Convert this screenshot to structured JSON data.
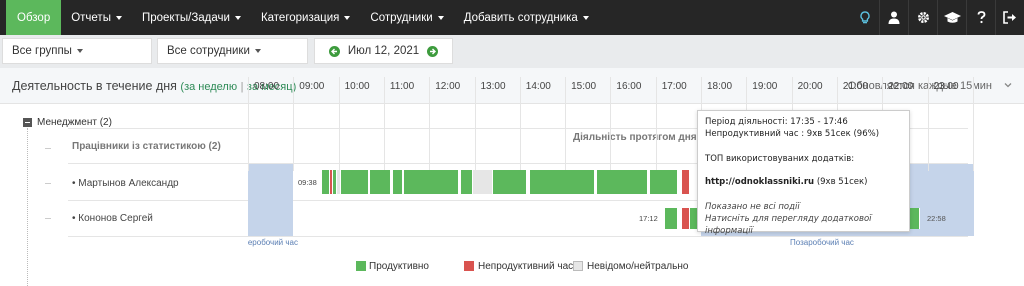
{
  "nav": {
    "items": [
      {
        "label": "Обзор",
        "active": true,
        "caret": false
      },
      {
        "label": "Отчеты",
        "caret": true
      },
      {
        "label": "Проекты/Задачи",
        "caret": true
      },
      {
        "label": "Категоризация",
        "caret": true
      },
      {
        "label": "Сотрудники",
        "caret": true
      },
      {
        "label": "Добавить сотрудника",
        "caret": true
      }
    ],
    "icons": [
      "lightbulb-icon",
      "user-icon",
      "gear-icon",
      "graduation-cap-icon",
      "help-icon",
      "logout-icon"
    ],
    "accent": "#5cb85c",
    "bg": "#262626"
  },
  "filters": {
    "groups": "Все группы",
    "employees": "Все сотрудники",
    "date": "Июл 12, 2021"
  },
  "panel": {
    "title": "Деятельность в течение дня",
    "link_week": "за неделю",
    "separator": "|",
    "link_month": "за месяц",
    "paren_open": "(",
    "paren_close": ")",
    "update_note": "Обновляется каждые 15мин"
  },
  "tree": {
    "group_label": "Менеджмент (2)",
    "column_title": "Працівники із статистикою (2)",
    "axis_title": "Діяльність протягом дня",
    "employees": [
      {
        "name": "• Мартынов Александр",
        "start_label": "09:38"
      },
      {
        "name": "• Кононов Сергей",
        "start_label": "17:12",
        "end_label": "22:58"
      }
    ]
  },
  "hours": [
    "08:00",
    "09:00",
    "10:00",
    "11:00",
    "12:00",
    "13:00",
    "14:00",
    "15:00",
    "16:00",
    "17:00",
    "18:00",
    "19:00",
    "20:00",
    "21:00",
    "22:00",
    "23:00"
  ],
  "nonwork_left": "Неробочий час",
  "nonwork_right": "Позаробочий час",
  "legend": {
    "productive": "Продуктивно",
    "unproductive": "Непродуктивний час",
    "neutral": "Невідомо/нейтрально"
  },
  "colors": {
    "productive": "#5cb85c",
    "unproductive": "#d9534f",
    "neutral": "#e6e6e6",
    "offhours": "#c5d4ea"
  },
  "tooltip": {
    "period": "Період діяльності: 17:35 - 17:46",
    "unproductive": "Непродуктивний час : 9хв 51сек (96%)",
    "top_apps": "ТОП використовуваних додатків:",
    "app_name": "http://odnoklassniki.ru",
    "app_time": "(9хв 51сек)",
    "note1": "Показано не всі події",
    "note2": "Натисніть для перегляду додаткової інформації"
  },
  "activity": {
    "row1": [
      {
        "from": "09:38",
        "to": "09:48",
        "type": "productive"
      },
      {
        "from": "09:48",
        "to": "09:52",
        "type": "unproductive"
      },
      {
        "from": "09:52",
        "to": "09:58",
        "type": "productive"
      },
      {
        "from": "09:58",
        "to": "10:03",
        "type": "neutral"
      },
      {
        "from": "10:03",
        "to": "10:40",
        "type": "productive"
      },
      {
        "from": "10:42",
        "to": "11:10",
        "type": "productive"
      },
      {
        "from": "11:12",
        "to": "11:25",
        "type": "productive"
      },
      {
        "from": "11:27",
        "to": "12:40",
        "type": "productive"
      },
      {
        "from": "12:42",
        "to": "12:58",
        "type": "productive"
      },
      {
        "from": "12:58",
        "to": "13:25",
        "type": "neutral"
      },
      {
        "from": "13:25",
        "to": "14:10",
        "type": "productive"
      },
      {
        "from": "14:13",
        "to": "15:40",
        "type": "productive"
      },
      {
        "from": "15:42",
        "to": "16:50",
        "type": "productive"
      },
      {
        "from": "16:52",
        "to": "17:30",
        "type": "productive"
      },
      {
        "from": "17:35",
        "to": "17:46",
        "type": "unproductive"
      }
    ],
    "row2": [
      {
        "from": "17:12",
        "to": "17:30",
        "type": "productive"
      },
      {
        "from": "17:35",
        "to": "17:46",
        "type": "unproductive"
      },
      {
        "from": "17:46",
        "to": "18:00",
        "type": "productive"
      },
      {
        "from": "18:00",
        "to": "18:40",
        "type": "productive"
      },
      {
        "from": "18:42",
        "to": "20:20",
        "type": "productive"
      },
      {
        "from": "20:22",
        "to": "21:50",
        "type": "productive"
      },
      {
        "from": "21:50",
        "to": "22:00",
        "type": "unproductive"
      },
      {
        "from": "22:00",
        "to": "22:50",
        "type": "productive"
      }
    ]
  }
}
